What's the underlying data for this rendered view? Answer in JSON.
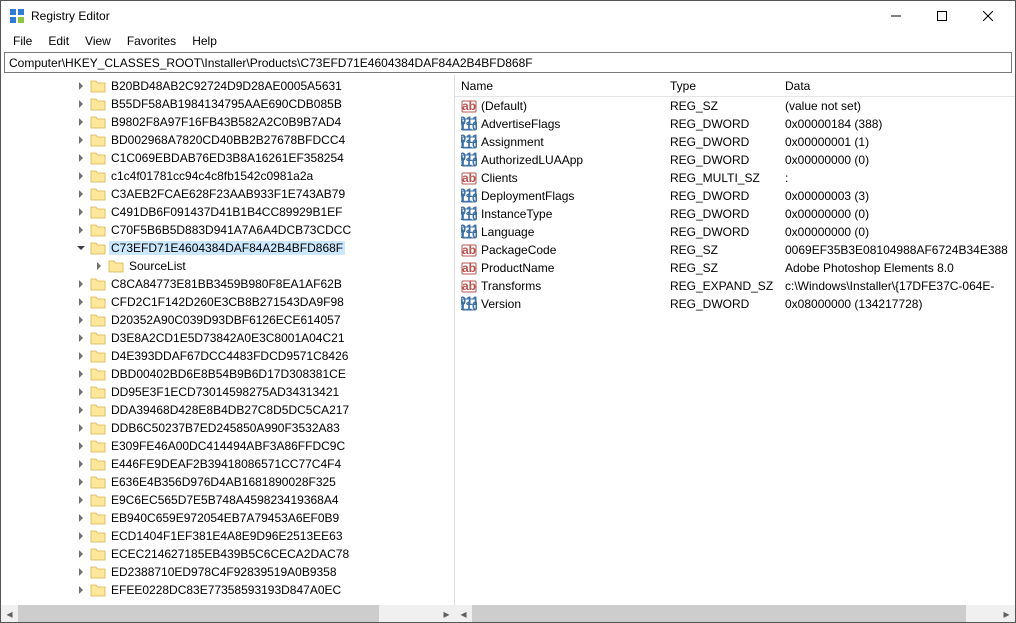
{
  "window": {
    "title": "Registry Editor"
  },
  "menu": {
    "file": "File",
    "edit": "Edit",
    "view": "View",
    "favorites": "Favorites",
    "help": "Help"
  },
  "address": "Computer\\HKEY_CLASSES_ROOT\\Installer\\Products\\C73EFD71E4604384DAF84A2B4BFD868F",
  "tree": {
    "selected": "C73EFD71E4604384DAF84A2B4BFD868F",
    "child": "SourceList",
    "siblings_before": [
      "B20BD48AB2C92724D9D28AE0005A5631",
      "B55DF58AB1984134795AAE690CDB085B",
      "B9802F8A97F16FB43B582A2C0B9B7AD4",
      "BD002968A7820CD40BB2B27678BFDCC4",
      "C1C069EBDAB76ED3B8A16261EF358254",
      "c1c4f01781cc94c4c8fb1542c0981a2a",
      "C3AEB2FCAE628F23AAB933F1E743AB79",
      "C491DB6F091437D41B1B4CC89929B1EF",
      "C70F5B6B5D883D941A7A6A4DCB73CDCC"
    ],
    "siblings_after": [
      "C8CA84773E81BB3459B980F8EA1AF62B",
      "CFD2C1F142D260E3CB8B271543DA9F98",
      "D20352A90C039D93DBF6126ECE614057",
      "D3E8A2CD1E5D73842A0E3C8001A04C21",
      "D4E393DDAF67DCC4483FDCD9571C8426",
      "DBD00402BD6E8B54B9B6D17D308381CE",
      "DD95E3F1ECD73014598275AD34313421",
      "DDA39468D428E8B4DB27C8D5DC5CA217",
      "DDB6C50237B7ED245850A990F3532A83",
      "E309FE46A00DC414494ABF3A86FFDC9C",
      "E446FE9DEAF2B39418086571CC77C4F4",
      "E636E4B356D976D4AB1681890028F325",
      "E9C6EC565D7E5B748A459823419368A4",
      "EB940C659E972054EB7A79453A6EF0B9",
      "ECD1404F1EF381E4A8E9D96E2513EE63",
      "ECEC214627185EB439B5C6CECA2DAC78",
      "ED2388710ED978C4F92839519A0B9358",
      "EFEE0228DC83E77358593193D847A0EC"
    ]
  },
  "columns": {
    "name": "Name",
    "type": "Type",
    "data": "Data"
  },
  "values": [
    {
      "icon": "str",
      "name": "(Default)",
      "type": "REG_SZ",
      "data": "(value not set)"
    },
    {
      "icon": "bin",
      "name": "AdvertiseFlags",
      "type": "REG_DWORD",
      "data": "0x00000184 (388)"
    },
    {
      "icon": "bin",
      "name": "Assignment",
      "type": "REG_DWORD",
      "data": "0x00000001 (1)"
    },
    {
      "icon": "bin",
      "name": "AuthorizedLUAApp",
      "type": "REG_DWORD",
      "data": "0x00000000 (0)"
    },
    {
      "icon": "str",
      "name": "Clients",
      "type": "REG_MULTI_SZ",
      "data": ":"
    },
    {
      "icon": "bin",
      "name": "DeploymentFlags",
      "type": "REG_DWORD",
      "data": "0x00000003 (3)"
    },
    {
      "icon": "bin",
      "name": "InstanceType",
      "type": "REG_DWORD",
      "data": "0x00000000 (0)"
    },
    {
      "icon": "bin",
      "name": "Language",
      "type": "REG_DWORD",
      "data": "0x00000000 (0)"
    },
    {
      "icon": "str",
      "name": "PackageCode",
      "type": "REG_SZ",
      "data": "0069EF35B3E08104988AF6724B34E388"
    },
    {
      "icon": "str",
      "name": "ProductName",
      "type": "REG_SZ",
      "data": "Adobe Photoshop Elements 8.0"
    },
    {
      "icon": "str",
      "name": "Transforms",
      "type": "REG_EXPAND_SZ",
      "data": "c:\\Windows\\Installer\\{17DFE37C-064E-"
    },
    {
      "icon": "bin",
      "name": "Version",
      "type": "REG_DWORD",
      "data": "0x08000000 (134217728)"
    }
  ]
}
